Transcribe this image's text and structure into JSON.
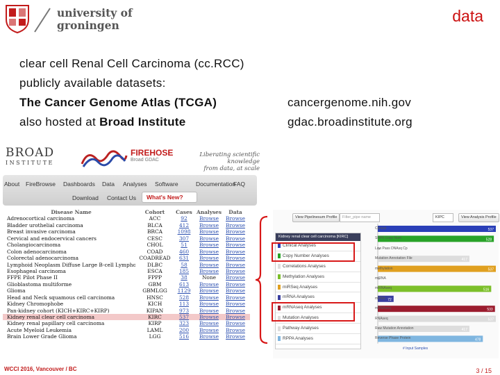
{
  "header": {
    "logo_line1": "university of",
    "logo_line2": "groningen",
    "title": "data"
  },
  "intro": {
    "line1": "clear cell Renal Cell Carcinoma (cc.RCC)",
    "line2": "publicly available datasets:",
    "line3_left": "The Cancer Genome Atlas (TCGA)",
    "line3_right": "cancergenome.nih.gov",
    "line4_prefix": "also hosted at ",
    "line4_bold": "Broad Institute",
    "line4_right": "gdac.broadinstitute.org"
  },
  "portal": {
    "broad_line1": "BROAD",
    "broad_line2": "INSTITUTE",
    "firehose_title": "FIREHOSE",
    "firehose_subtitle": "Broad GDAC",
    "tagline_line1": "Liberating scientific knowledge",
    "tagline_line2": "from data, at scale",
    "nav": [
      "About",
      "FireBrowse",
      "Dashboards",
      "Data",
      "Analyses",
      "Software",
      "Documentation",
      "FAQ"
    ],
    "nav_row2": [
      "Download",
      "Contact Us"
    ],
    "whats_new": "What's New?"
  },
  "table": {
    "headers": [
      "Disease Name",
      "Cohort",
      "Cases",
      "Analyses",
      "Data"
    ],
    "rows": [
      [
        "Adrenocortical carcinoma",
        "ACC",
        "92",
        "Browse",
        "Browse"
      ],
      [
        "Bladder urothelial carcinoma",
        "BLCA",
        "412",
        "Browse",
        "Browse"
      ],
      [
        "Breast invasive carcinoma",
        "BRCA",
        "1098",
        "Browse",
        "Browse"
      ],
      [
        "Cervical and endocervical cancers",
        "CESC",
        "307",
        "Browse",
        "Browse"
      ],
      [
        "Cholangiocarcinoma",
        "CHOL",
        "51",
        "Browse",
        "Browse"
      ],
      [
        "Colon adenocarcinoma",
        "COAD",
        "460",
        "Browse",
        "Browse"
      ],
      [
        "Colorectal adenocarcinoma",
        "COADREAD",
        "631",
        "Browse",
        "Browse"
      ],
      [
        "Lymphoid Neoplasm Diffuse Large B-cell Lymphoma",
        "DLBC",
        "58",
        "Browse",
        "Browse"
      ],
      [
        "Esophageal carcinoma",
        "ESCA",
        "185",
        "Browse",
        "Browse"
      ],
      [
        "FFPE Pilot Phase II",
        "FPPP",
        "38",
        "None",
        "Browse"
      ],
      [
        "Glioblastoma multiforme",
        "GBM",
        "613",
        "Browse",
        "Browse"
      ],
      [
        "Glioma",
        "GBMLGG",
        "1129",
        "Browse",
        "Browse"
      ],
      [
        "Head and Neck squamous cell carcinoma",
        "HNSC",
        "528",
        "Browse",
        "Browse"
      ],
      [
        "Kidney Chromophobe",
        "KICH",
        "113",
        "Browse",
        "Browse"
      ],
      [
        "Pan-kidney cohort (KICH+KIRC+KIRP)",
        "KIPAN",
        "973",
        "Browse",
        "Browse"
      ],
      [
        "Kidney renal clear cell carcinoma",
        "KIRC",
        "537",
        "Browse",
        "Browse"
      ],
      [
        "Kidney renal papillary cell carcinoma",
        "KIRP",
        "323",
        "Browse",
        "Browse"
      ],
      [
        "Acute Myeloid Leukemia",
        "LAML",
        "200",
        "Browse",
        "Browse"
      ],
      [
        "Brain Lower Grade Glioma",
        "LGG",
        "516",
        "Browse",
        "Browse"
      ]
    ],
    "highlighted_row": 15
  },
  "report": {
    "view_button": "View Pipelinesum Profile",
    "filter_placeholder": "Filter_pipe name",
    "cohort_value": "KIPC",
    "profile_button": "View Analysis Profile",
    "list_header": "Kidney renal clear cell carcinoma [KIRC]",
    "list_items": [
      {
        "label": "Clinical Analyses",
        "color": "#2a3fb8"
      },
      {
        "label": "Copy Number Analyses",
        "color": "#29a329"
      },
      {
        "label": "Correlations Analyses",
        "color": "#dddddd"
      },
      {
        "label": "Methylation Analyses",
        "color": "#7cbf2a"
      },
      {
        "label": "miRSeq Analyses",
        "color": "#e0a020"
      },
      {
        "label": "mRNA Analyses",
        "color": "#3a3fa0"
      },
      {
        "label": "mRNAseq Analyses",
        "color": "#9b1c2e"
      },
      {
        "label": "Mutation Analyses",
        "color": "#dddddd"
      },
      {
        "label": "Pathway Analyses",
        "color": "#dddddd"
      },
      {
        "label": "RPPA Analyses",
        "color": "#7fb6e0"
      }
    ],
    "chart": {
      "categories": [
        "Clinical",
        "SNP6 Copy Num",
        "Low Pass DNAsq Cp",
        "Mutation Annotation File",
        "methylation",
        "miRNA",
        "miRNAseq",
        "mRNA",
        "mRNAseq",
        "RNAseq",
        "Raw Mutation Annotation",
        "Reverse Phase Protein"
      ],
      "values": [
        537,
        528,
        null,
        417,
        537,
        null,
        516,
        72,
        533,
        537,
        417,
        478
      ],
      "colors": [
        "#2a3fb8",
        "#29a329",
        "#cccccc",
        "#dddddd",
        "#e0a020",
        "#cccccc",
        "#7cbf2a",
        "#3a3fa0",
        "#9b1c2e",
        "#dddddd",
        "#dddddd",
        "#7fb6e0"
      ],
      "xlabel": "# Input Samples"
    }
  },
  "footer": {
    "left": "WCCI 2016, Vancouver / BC",
    "page": "3 / 15"
  }
}
